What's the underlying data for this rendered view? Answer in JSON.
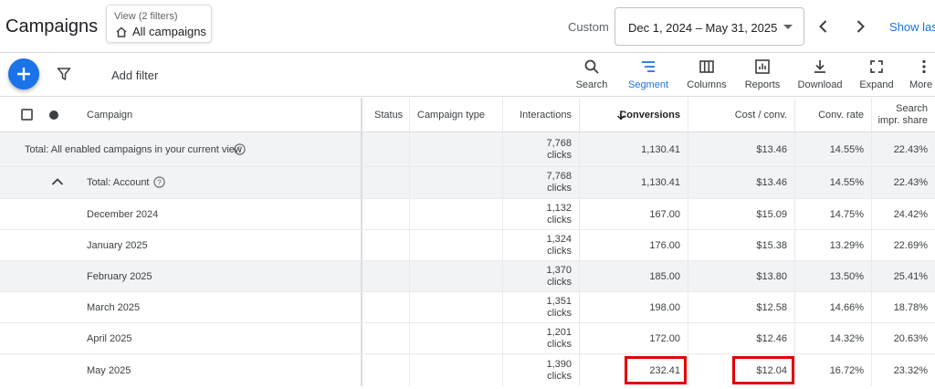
{
  "header": {
    "title": "Campaigns",
    "view_label": "View (2 filters)",
    "view_value": "All campaigns",
    "custom_label": "Custom",
    "date_range": "Dec 1, 2024 – May 31, 2025",
    "show_last": "Show last"
  },
  "toolbar": {
    "add_filter": "Add filter",
    "tools": [
      {
        "label": "Search",
        "icon": "search-icon"
      },
      {
        "label": "Segment",
        "icon": "segment-icon",
        "active": true
      },
      {
        "label": "Columns",
        "icon": "columns-icon"
      },
      {
        "label": "Reports",
        "icon": "reports-icon"
      },
      {
        "label": "Download",
        "icon": "download-icon"
      },
      {
        "label": "Expand",
        "icon": "expand-icon"
      },
      {
        "label": "More",
        "icon": "more-vert-icon"
      }
    ]
  },
  "table": {
    "headers": {
      "campaign": "Campaign",
      "status": "Status",
      "campaign_type": "Campaign type",
      "interactions": "Interactions",
      "conversions": "Conversions",
      "cost_per_conv": "Cost / conv.",
      "conv_rate": "Conv. rate",
      "search_impr_share_1": "Search",
      "search_impr_share_2": "impr. share"
    },
    "rows": [
      {
        "label": "Total: All enabled campaigns in your current view",
        "interactions": "7,768",
        "unit": "clicks",
        "conversions": "1,130.41",
        "cost": "$13.46",
        "rate": "14.55%",
        "share": "22.43%"
      },
      {
        "label": "Total: Account",
        "interactions": "7,768",
        "unit": "clicks",
        "conversions": "1,130.41",
        "cost": "$13.46",
        "rate": "14.55%",
        "share": "22.43%"
      },
      {
        "label": "December 2024",
        "interactions": "1,132",
        "unit": "clicks",
        "conversions": "167.00",
        "cost": "$15.09",
        "rate": "14.75%",
        "share": "24.42%"
      },
      {
        "label": "January 2025",
        "interactions": "1,324",
        "unit": "clicks",
        "conversions": "176.00",
        "cost": "$15.38",
        "rate": "13.29%",
        "share": "22.69%"
      },
      {
        "label": "February 2025",
        "interactions": "1,370",
        "unit": "clicks",
        "conversions": "185.00",
        "cost": "$13.80",
        "rate": "13.50%",
        "share": "25.41%"
      },
      {
        "label": "March 2025",
        "interactions": "1,351",
        "unit": "clicks",
        "conversions": "198.00",
        "cost": "$12.58",
        "rate": "14.66%",
        "share": "18.78%"
      },
      {
        "label": "April 2025",
        "interactions": "1,201",
        "unit": "clicks",
        "conversions": "172.00",
        "cost": "$12.46",
        "rate": "14.32%",
        "share": "20.63%"
      },
      {
        "label": "May 2025",
        "interactions": "1,390",
        "unit": "clicks",
        "conversions": "232.41",
        "cost": "$12.04",
        "rate": "16.72%",
        "share": "23.32%"
      }
    ]
  },
  "colors": {
    "accent": "#1a73e8",
    "highlight": "#e00000"
  }
}
